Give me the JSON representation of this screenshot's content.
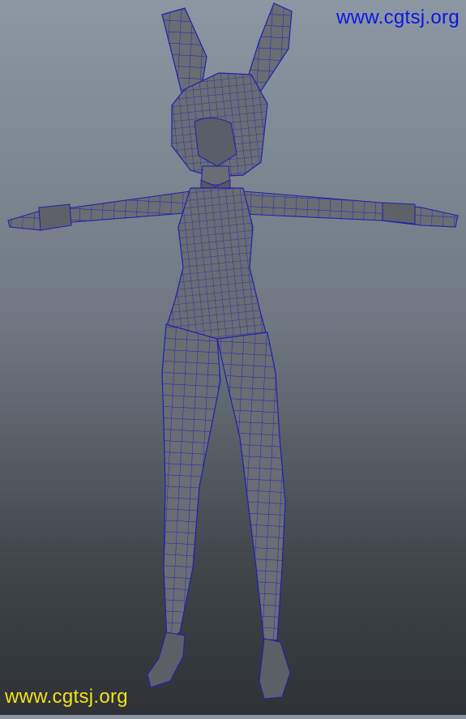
{
  "viewport": {
    "background_top": "#8c97a3",
    "background_bottom": "#2e3236",
    "model_fill": "#6a6d74",
    "wire_color": "#1f1fb0"
  },
  "watermark_top": {
    "text": "www.cgtsj.org",
    "color": "#0a16e6"
  },
  "watermark_bottom": {
    "text": "www.cgtsj.org",
    "color": "#f2e21a"
  },
  "model": {
    "name": "bunny-girl-wireframe-model",
    "pose": "T-pose"
  }
}
